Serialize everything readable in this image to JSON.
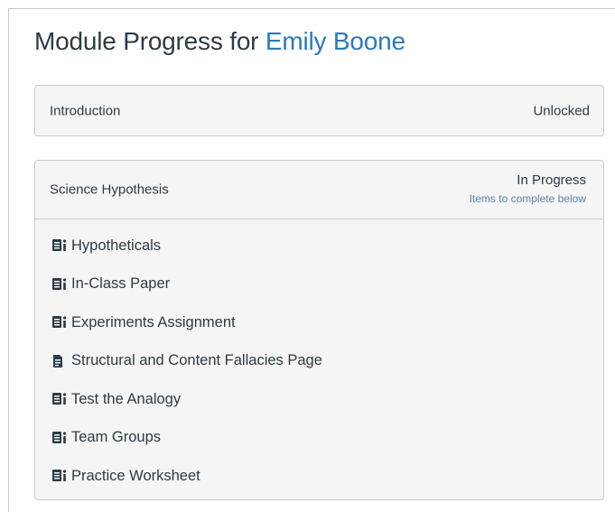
{
  "page": {
    "title_prefix": "Module Progress for",
    "student_name": "Emily Boone"
  },
  "modules": [
    {
      "name": "Introduction",
      "status": "Unlocked"
    },
    {
      "name": "Science Hypothesis",
      "status": "In Progress",
      "status_detail": "Items to complete below",
      "items": [
        {
          "label": "Hypotheticals",
          "icon": "assignment-icon"
        },
        {
          "label": "In-Class Paper",
          "icon": "assignment-icon"
        },
        {
          "label": "Experiments Assignment",
          "icon": "assignment-icon"
        },
        {
          "label": "Structural and Content Fallacies Page",
          "icon": "page-icon"
        },
        {
          "label": "Test the Analogy",
          "icon": "assignment-icon"
        },
        {
          "label": "Team Groups",
          "icon": "assignment-icon"
        },
        {
          "label": "Practice Worksheet",
          "icon": "assignment-icon"
        }
      ]
    }
  ],
  "colors": {
    "student_link": "#2b7abc",
    "text": "#2d3b45",
    "status_detail": "#5b83a9",
    "panel_bg": "#f5f5f5",
    "border": "#c7cdd1"
  }
}
